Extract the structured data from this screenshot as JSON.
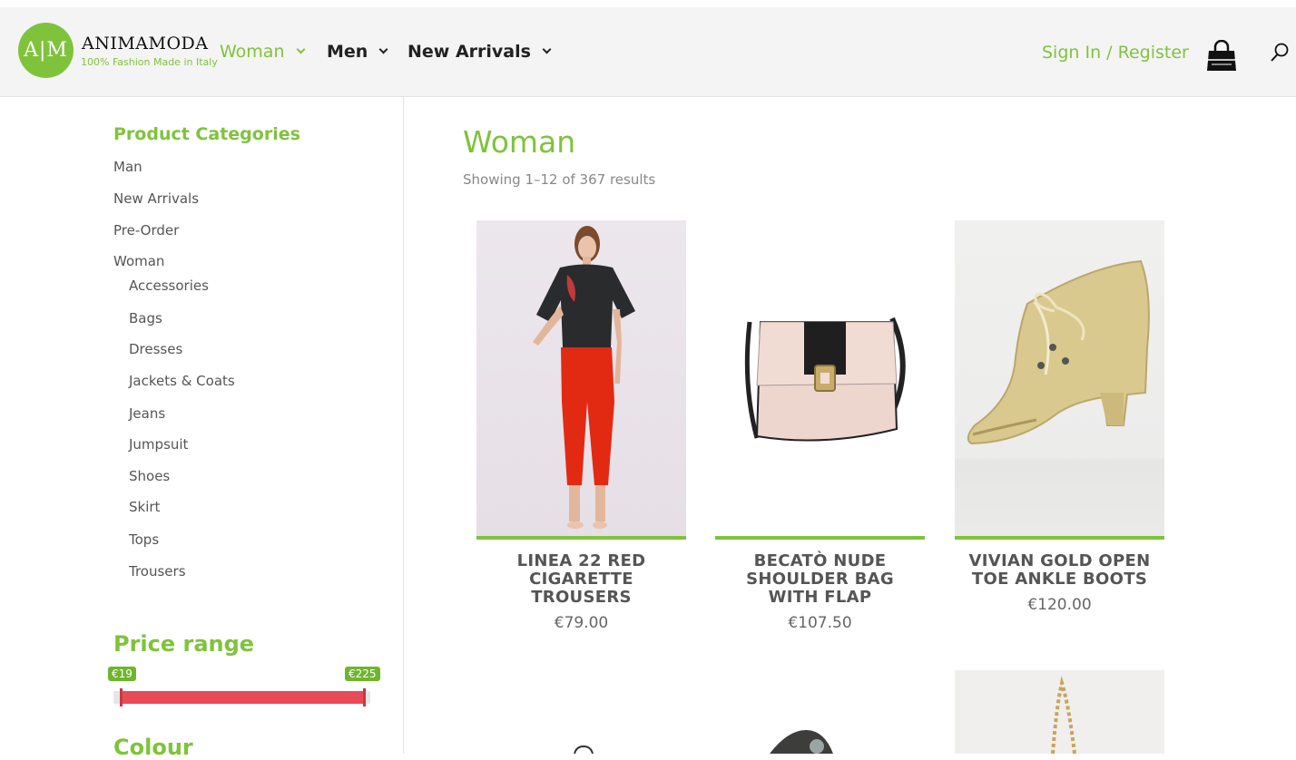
{
  "brand": {
    "monogram": "A|M",
    "name": "ANIMAMODA",
    "tagline": "100% Fashion Made in Italy",
    "accent_color": "#7fc33c"
  },
  "nav": {
    "items": [
      {
        "label": "Woman",
        "active": true
      },
      {
        "label": "Men",
        "active": false
      },
      {
        "label": "New Arrivals",
        "active": false
      }
    ],
    "sign_in": "Sign In / Register",
    "cart_icon": "shopping-bag-icon",
    "search_icon": "search-icon"
  },
  "sidebar": {
    "categories_title": "Product Categories",
    "categories": [
      {
        "label": "Man"
      },
      {
        "label": "New Arrivals"
      },
      {
        "label": "Pre-Order"
      },
      {
        "label": "Woman"
      }
    ],
    "subcategories": [
      {
        "label": "Accessories"
      },
      {
        "label": "Bags"
      },
      {
        "label": "Dresses"
      },
      {
        "label": "Jackets & Coats"
      },
      {
        "label": "Jeans"
      },
      {
        "label": "Jumpsuit"
      },
      {
        "label": "Shoes"
      },
      {
        "label": "Skirt"
      },
      {
        "label": "Tops"
      },
      {
        "label": "Trousers"
      }
    ],
    "price_title": "Price range",
    "price_min": "€19",
    "price_max": "€225",
    "slider_color": "#e84b57",
    "colour_title": "Colour"
  },
  "main": {
    "title": "Woman",
    "results": "Showing 1–12 of 367 results",
    "products": [
      {
        "name": "LINEA 22 RED CIGARETTE TROUSERS",
        "price": "€79.00"
      },
      {
        "name": "BECATÒ NUDE SHOULDER BAG WITH FLAP",
        "price": "€107.50"
      },
      {
        "name": "VIVIAN GOLD OPEN TOE ANKLE BOOTS",
        "price": "€120.00"
      }
    ]
  }
}
